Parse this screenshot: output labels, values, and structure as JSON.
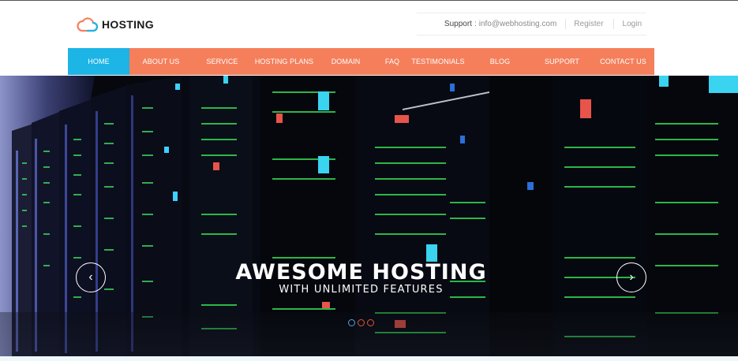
{
  "brand": {
    "name": "HOSTING",
    "logo_icon": "cloud-icon",
    "logo_colors": [
      "#f57f5b",
      "#1db4e6"
    ]
  },
  "toplinks": {
    "support_label": "Support",
    "support_separator": ":",
    "support_email": "info@webhosting.com",
    "register": "Register",
    "login": "Login"
  },
  "nav": {
    "items": [
      {
        "label": "HOME",
        "active": true
      },
      {
        "label": "ABOUT US"
      },
      {
        "label": "SERVICE"
      },
      {
        "label": "HOSTING PLANS"
      },
      {
        "label": "DOMAIN"
      },
      {
        "label": "FAQ"
      },
      {
        "label": "TESTIMONIALS"
      },
      {
        "label": "BLOG"
      },
      {
        "label": "SUPPORT"
      },
      {
        "label": "CONTACT US"
      }
    ],
    "bg_color": "#f57f5b",
    "active_color": "#1db4e6"
  },
  "hero": {
    "title": "AWESOME HOSTING",
    "subtitle": "WITH UNLIMITED FEATURES",
    "prev_icon": "chevron-left-icon",
    "next_icon": "chevron-right-icon",
    "prev_glyph": "‹",
    "next_glyph": "›",
    "slide_count": 3,
    "active_slide": 1
  }
}
